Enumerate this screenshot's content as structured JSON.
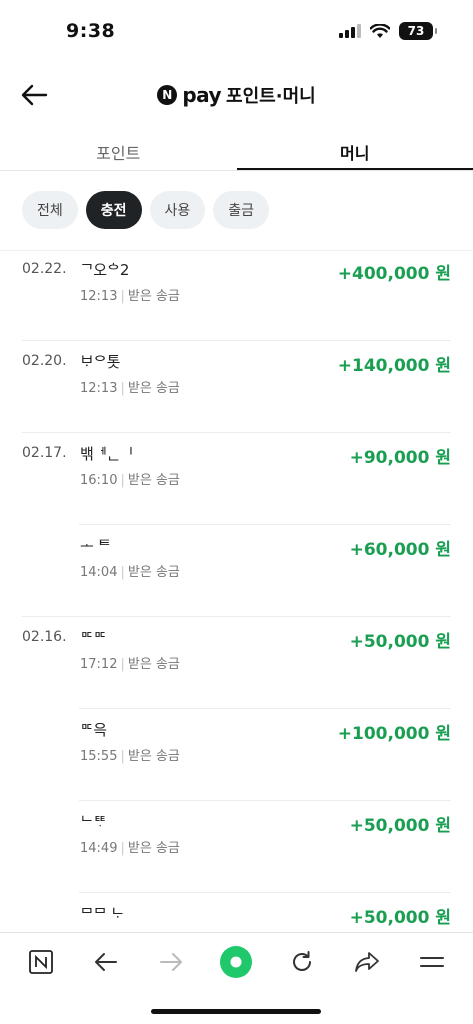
{
  "status": {
    "time": "9:38",
    "battery": "73"
  },
  "header": {
    "logo_letter": "N",
    "pay": "pay",
    "title": "포인트·머니"
  },
  "tabs": [
    {
      "label": "포인트"
    },
    {
      "label": "머니"
    }
  ],
  "chips": [
    {
      "label": "전체"
    },
    {
      "label": "충전"
    },
    {
      "label": "사용"
    },
    {
      "label": "출금"
    }
  ],
  "transactions": [
    {
      "date": "02.22.",
      "name": "ᄀ오ᅌ2",
      "time": "12:13",
      "type": "받은 송금",
      "amount": "+400,000 원"
    },
    {
      "date": "02.20.",
      "name": "ᄇᆞᄋ톳ᅟ",
      "time": "12:13",
      "type": "받은 송금",
      "amount": "+140,000 원"
    },
    {
      "date": "02.17.",
      "name": "밲ᅦᆫᅵ",
      "time": "16:10",
      "type": "받은 송금",
      "amount": "+90,000 원"
    },
    {
      "date": "",
      "name": "ᅩ ᄐ",
      "time": "14:04",
      "type": "받은 송금",
      "amount": "+60,000 원"
    },
    {
      "date": "02.16.",
      "name": "ᄆᄃᄆᄃ",
      "time": "17:12",
      "type": "받은 송금",
      "amount": "+50,000 원"
    },
    {
      "date": "",
      "name": "ᄆᄃ윽",
      "time": "15:55",
      "type": "받은 송금",
      "amount": "+100,000 원"
    },
    {
      "date": "",
      "name": "ᄂᄐᄐᆞ",
      "time": "14:49",
      "type": "받은 송금",
      "amount": "+50,000 원"
    },
    {
      "date": "",
      "name": "ᄆᄆ ᄂᆞ",
      "time": "",
      "type": "",
      "amount": "+50,000 원"
    }
  ],
  "colors": {
    "accent_green": "#1a9e52",
    "active_chip": "#1f2326",
    "browser_dot": "#1ec86b"
  },
  "toolbar_icons": [
    "naver-n-icon",
    "back-arrow-icon",
    "forward-arrow-icon",
    "green-dot-icon",
    "refresh-icon",
    "share-icon",
    "menu-icon"
  ]
}
